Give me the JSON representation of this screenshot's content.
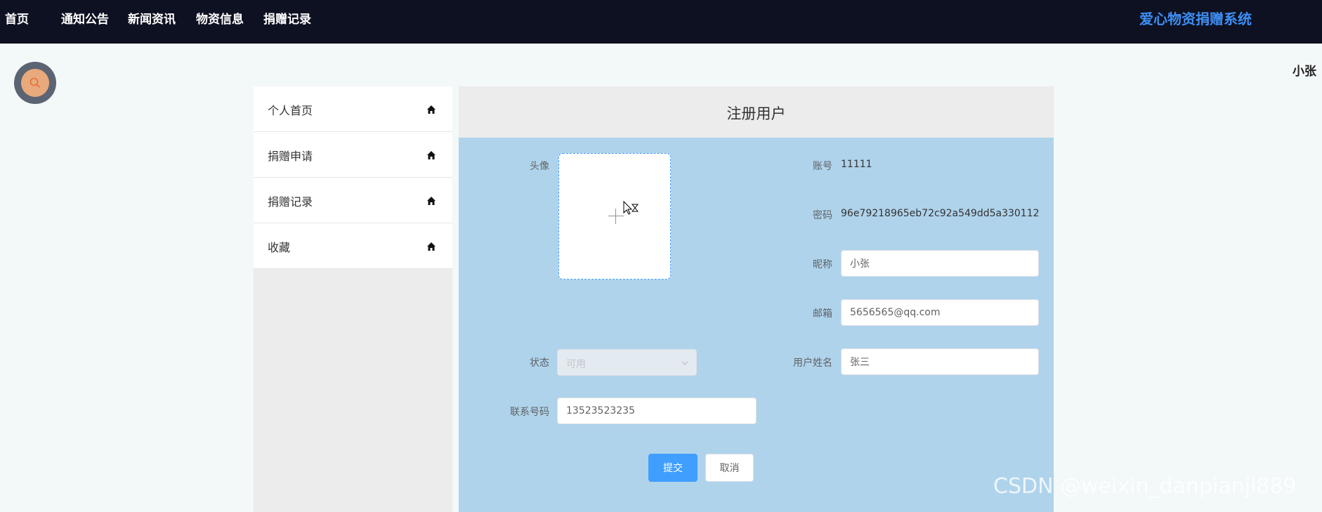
{
  "nav": {
    "items": [
      {
        "label": "首页"
      },
      {
        "label": "通知公告"
      },
      {
        "label": "新闻资讯"
      },
      {
        "label": "物资信息"
      },
      {
        "label": "捐赠记录"
      }
    ],
    "brand": "爱心物资捐赠系统"
  },
  "user": {
    "name": "小张"
  },
  "icons": {
    "search": "search-icon",
    "house": "house-icon",
    "chevron": "chevron-down-icon"
  },
  "sidebar": {
    "items": [
      {
        "label": "个人首页"
      },
      {
        "label": "捐赠申请"
      },
      {
        "label": "捐赠记录"
      },
      {
        "label": "收藏"
      }
    ]
  },
  "form": {
    "title": "注册用户",
    "avatar_label": "头像",
    "account_label": "账号",
    "account_value": "11111",
    "password_label": "密码",
    "password_value": "96e79218965eb72c92a549dd5a330112",
    "nickname_label": "昵称",
    "nickname_value": "小张",
    "email_label": "邮箱",
    "email_value": "5656565@qq.com",
    "status_label": "状态",
    "status_value": "可用",
    "realname_label": "用户姓名",
    "realname_value": "张三",
    "phone_label": "联系号码",
    "phone_value": "13523523235",
    "submit_label": "提交",
    "cancel_label": "取消"
  },
  "watermark": "CSDN @weixin_danpianji889",
  "colors": {
    "topbar": "#0e1121",
    "brand": "#3d8ff5",
    "form_bg": "#afd3eb",
    "primary": "#409eff"
  }
}
